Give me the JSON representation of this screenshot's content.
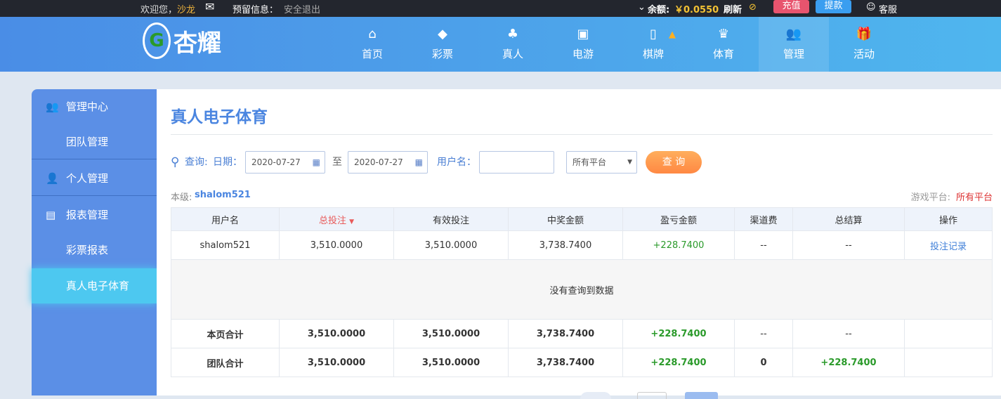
{
  "topbar": {
    "welcome": "欢迎您，",
    "user": "沙龙",
    "reserved": "预留信息：",
    "logout": "安全退出",
    "balance_label": "余额:",
    "balance": "￥0.0550",
    "refresh": "刷新",
    "deposit": "充值",
    "withdraw": "提款",
    "service": "客服"
  },
  "logo": "杏耀",
  "nav": [
    {
      "label": "首页",
      "icon": "⌂"
    },
    {
      "label": "彩票",
      "icon": "◆"
    },
    {
      "label": "真人",
      "icon": "♣"
    },
    {
      "label": "电游",
      "icon": "▣"
    },
    {
      "label": "棋牌",
      "icon": "▯"
    },
    {
      "label": "体育",
      "icon": "♛"
    },
    {
      "label": "管理",
      "icon": "👥"
    },
    {
      "label": "活动",
      "icon": "🎁"
    }
  ],
  "sidebar": {
    "items": [
      "管理中心",
      "团队管理",
      "个人管理",
      "报表管理",
      "彩票报表",
      "真人电子体育"
    ]
  },
  "page": {
    "title": "真人电子体育",
    "query": "查询:",
    "date_label": "日期：",
    "date_from": "2020-07-27",
    "to": "至",
    "date_to": "2020-07-27",
    "username_label": "用户名：",
    "username": "",
    "platform": "所有平台",
    "search": "查 询",
    "level_label": "本级:",
    "level_user": "shalom521",
    "game_platform_label": "游戏平台:",
    "game_platform": "所有平台"
  },
  "table": {
    "headers": [
      "用户名",
      "总投注",
      "有效投注",
      "中奖金额",
      "盈亏金额",
      "渠道费",
      "总结算",
      "操作"
    ],
    "row": [
      "shalom521",
      "3,510.0000",
      "3,510.0000",
      "3,738.7400",
      "+228.7400",
      "--",
      "--",
      "投注记录"
    ],
    "empty": "没有查询到数据",
    "page_total": [
      "本页合计",
      "3,510.0000",
      "3,510.0000",
      "3,738.7400",
      "+228.7400",
      "--",
      "--",
      ""
    ],
    "team_total": [
      "团队合计",
      "3,510.0000",
      "3,510.0000",
      "3,738.7400",
      "+228.7400",
      "0",
      "+228.7400",
      ""
    ]
  }
}
